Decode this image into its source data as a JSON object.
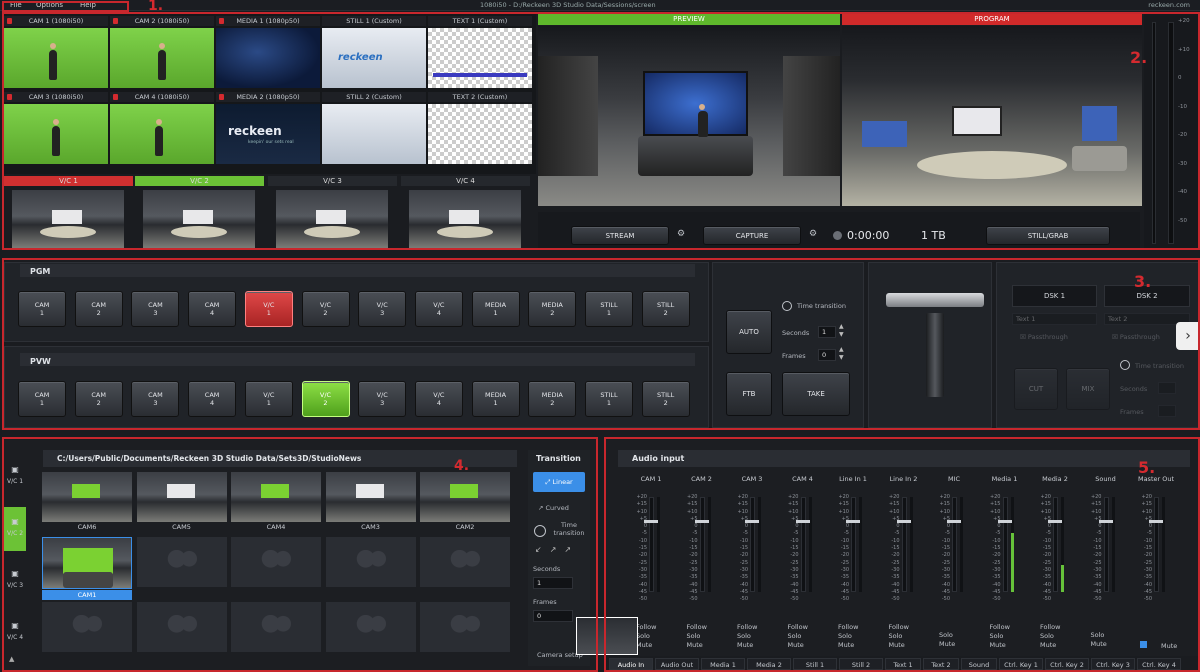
{
  "menu": {
    "file": "File",
    "options": "Options",
    "help": "Help",
    "title": "1080i50 - D:/Reckeen 3D Studio Data/Sessions/screen",
    "site": "reckeen.com"
  },
  "markers": [
    "1.",
    "2.",
    "3.",
    "4.",
    "5."
  ],
  "sources": [
    {
      "label": "CAM 1 (1080i50)"
    },
    {
      "label": "CAM 2 (1080i50)"
    },
    {
      "label": "MEDIA 1 (1080p50)"
    },
    {
      "label": "STILL 1 (Custom)"
    },
    {
      "label": "TEXT 1 (Custom)"
    },
    {
      "label": "CAM 3 (1080i50)"
    },
    {
      "label": "CAM 4 (1080i50)"
    },
    {
      "label": "MEDIA 2 (1080p50)"
    },
    {
      "label": "STILL 2 (Custom)"
    },
    {
      "label": "TEXT 2 (Custom)"
    }
  ],
  "still1_logo": "reckeen",
  "media2_logo": "reckeen",
  "media2_tagline": "keepin' our sets real",
  "virtual_cams": [
    "V/C 1",
    "V/C 2",
    "V/C 3",
    "V/C 4"
  ],
  "preview": {
    "label": "PREVIEW"
  },
  "program": {
    "label": "PROGRAM"
  },
  "controls": {
    "stream": "STREAM",
    "capture": "CAPTURE",
    "timer": "0:00:00",
    "disk": "1 TB",
    "still_grab": "STILL/GRAB"
  },
  "vu_scale": [
    "+20",
    "+10",
    "0",
    "-10",
    "-20",
    "-30",
    "-40",
    "-50"
  ],
  "pgm": {
    "label": "PGM",
    "buttons": [
      "CAM 1",
      "CAM 2",
      "CAM 3",
      "CAM 4",
      "V/C 1",
      "V/C 2",
      "V/C 3",
      "V/C 4",
      "MEDIA 1",
      "MEDIA 2",
      "STILL 1",
      "STILL 2"
    ],
    "active_index": 4
  },
  "pvw": {
    "label": "PVW",
    "buttons": [
      "CAM 1",
      "CAM 2",
      "CAM 3",
      "CAM 4",
      "V/C 1",
      "V/C 2",
      "V/C 3",
      "V/C 4",
      "MEDIA 1",
      "MEDIA 2",
      "STILL 1",
      "STILL 2"
    ],
    "active_index": 5
  },
  "transition_ctrl": {
    "auto": "AUTO",
    "time_transition": "Time transition",
    "seconds": "Seconds",
    "seconds_val": "1",
    "frames": "Frames",
    "frames_val": "0",
    "ftb": "FTB",
    "take": "TAKE"
  },
  "dsk": {
    "dsk1": "DSK 1",
    "dsk2": "DSK 2",
    "text1": "Text 1",
    "text2": "Text 2",
    "passthrough": "Passthrough",
    "time_transition": "Time transition",
    "cut": "CUT",
    "mix": "MIX",
    "seconds": "Seconds",
    "frames": "Frames"
  },
  "sets": {
    "path": "C:/Users/Public/Documents/Reckeen 3D Studio Data/Sets3D/StudioNews",
    "cams": [
      "CAM6",
      "CAM5",
      "CAM4",
      "CAM3",
      "CAM2",
      "CAM1"
    ],
    "side": [
      "V/C 1",
      "V/C 2",
      "V/C 3",
      "V/C 4"
    ]
  },
  "transition_panel": {
    "title": "Transition",
    "linear": "Linear",
    "curved": "Curved",
    "time_transition": "Time transition",
    "seconds": "Seconds",
    "seconds_val": "1",
    "frames": "Frames",
    "frames_val": "0",
    "camera_setup": "Camera setup"
  },
  "audio": {
    "title": "Audio input",
    "channels": [
      {
        "name": "CAM 1",
        "level": 0,
        "opts": [
          "Follow",
          "Solo",
          "Mute"
        ]
      },
      {
        "name": "CAM 2",
        "level": 0,
        "opts": [
          "Follow",
          "Solo",
          "Mute"
        ]
      },
      {
        "name": "CAM 3",
        "level": 0,
        "opts": [
          "Follow",
          "Solo",
          "Mute"
        ]
      },
      {
        "name": "CAM 4",
        "level": 0,
        "opts": [
          "Follow",
          "Solo",
          "Mute"
        ]
      },
      {
        "name": "Line In 1",
        "level": 0,
        "opts": [
          "Follow",
          "Solo",
          "Mute"
        ]
      },
      {
        "name": "Line In 2",
        "level": 0,
        "opts": [
          "Follow",
          "Solo",
          "Mute"
        ]
      },
      {
        "name": "MIC",
        "level": 0,
        "opts": [
          "Solo",
          "Mute"
        ]
      },
      {
        "name": "Media 1",
        "level": 0.62,
        "opts": [
          "Follow",
          "Solo",
          "Mute"
        ]
      },
      {
        "name": "Media 2",
        "level": 0.28,
        "opts": [
          "Follow",
          "Solo",
          "Mute"
        ]
      },
      {
        "name": "Sound",
        "level": 0,
        "opts": [
          "Solo",
          "Mute"
        ]
      },
      {
        "name": "Master Out",
        "level": 0,
        "opts": [
          "Mute"
        ]
      }
    ],
    "scale": [
      "+20",
      "+15",
      "+10",
      "+5",
      "0",
      "-5",
      "-10",
      "-15",
      "-20",
      "-25",
      "-30",
      "-35",
      "-40",
      "-45",
      "-50"
    ]
  },
  "tabs": [
    "Audio In",
    "Audio Out",
    "Media 1",
    "Media 2",
    "Still 1",
    "Still 2",
    "Text 1",
    "Text 2",
    "Sound",
    "Ctrl. Key 1",
    "Ctrl. Key 2",
    "Ctrl. Key 3",
    "Ctrl. Key 4"
  ],
  "colors": {
    "accent_red": "#d42a2f",
    "accent_green": "#7bd132",
    "blue": "#3b8fe8"
  }
}
